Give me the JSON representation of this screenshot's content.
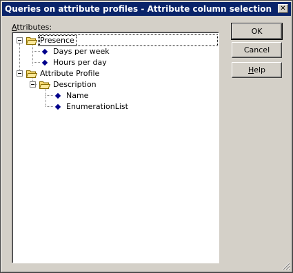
{
  "window": {
    "title": "Queries on attribute profiles - Attribute column selection",
    "close_glyph": "✕"
  },
  "attributes_label_first": "A",
  "attributes_label_rest": "ttributes:",
  "tree": {
    "items": [
      {
        "label": "Presence",
        "type": "folder",
        "expanded": true
      },
      {
        "label": "Days per week",
        "type": "attribute"
      },
      {
        "label": "Hours per day",
        "type": "attribute"
      },
      {
        "label": "Attribute Profile",
        "type": "folder",
        "expanded": true
      },
      {
        "label": "Description",
        "type": "folder",
        "expanded": true
      },
      {
        "label": "Name",
        "type": "attribute"
      },
      {
        "label": "EnumerationList",
        "type": "attribute"
      }
    ]
  },
  "buttons": {
    "ok": "OK",
    "cancel": "Cancel",
    "help_first": "H",
    "help_rest": "elp"
  },
  "colors": {
    "titlebar": "#0a246a",
    "face": "#d4d0c8",
    "diamond": "#00008b",
    "folder": "#f5d76e"
  }
}
